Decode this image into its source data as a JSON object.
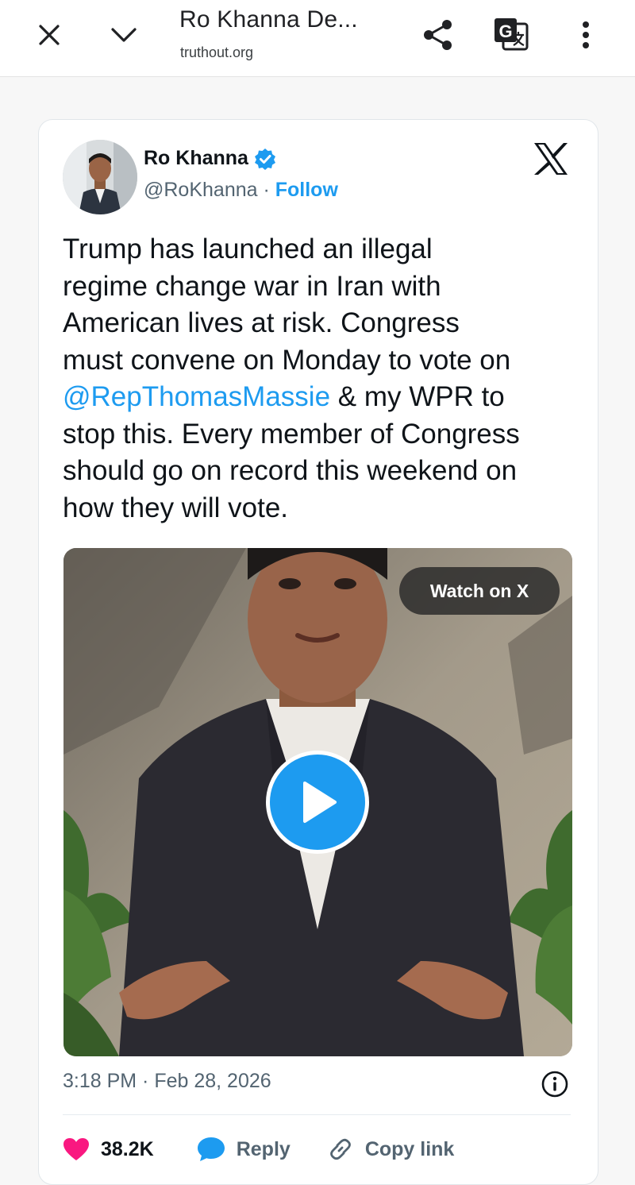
{
  "browser": {
    "title": "Ro Khanna De...",
    "url": "truthout.org",
    "icons": [
      "close-icon",
      "chevron-down-icon",
      "share-icon",
      "translate-icon",
      "more-vertical-icon"
    ]
  },
  "tweet": {
    "author_name": "Ro Khanna",
    "handle": "@RoKhanna",
    "separator": " · ",
    "follow_label": "Follow",
    "text_line_1": "Trump has launched an illegal",
    "text_line_2": "regime change war in Iran with",
    "text_line_3": "American lives at risk. Congress",
    "text_line_4": "must convene on Monday to vote on",
    "mention": "@RepThomasMassie",
    "text_line_5_rest": " & my WPR to",
    "text_line_6": "stop this. Every member of Congress",
    "text_line_7": "should go on record this weekend on",
    "text_line_8": "how they will vote.",
    "video": {
      "watch_label": "Watch on X"
    },
    "timestamp": "3:18 PM · Feb 28, 2026",
    "actions": {
      "like_count": "38.2K",
      "reply_label": "Reply",
      "copy_link_label": "Copy link"
    },
    "colors": {
      "accent": "#1d9bf0",
      "like": "#f91880"
    }
  }
}
